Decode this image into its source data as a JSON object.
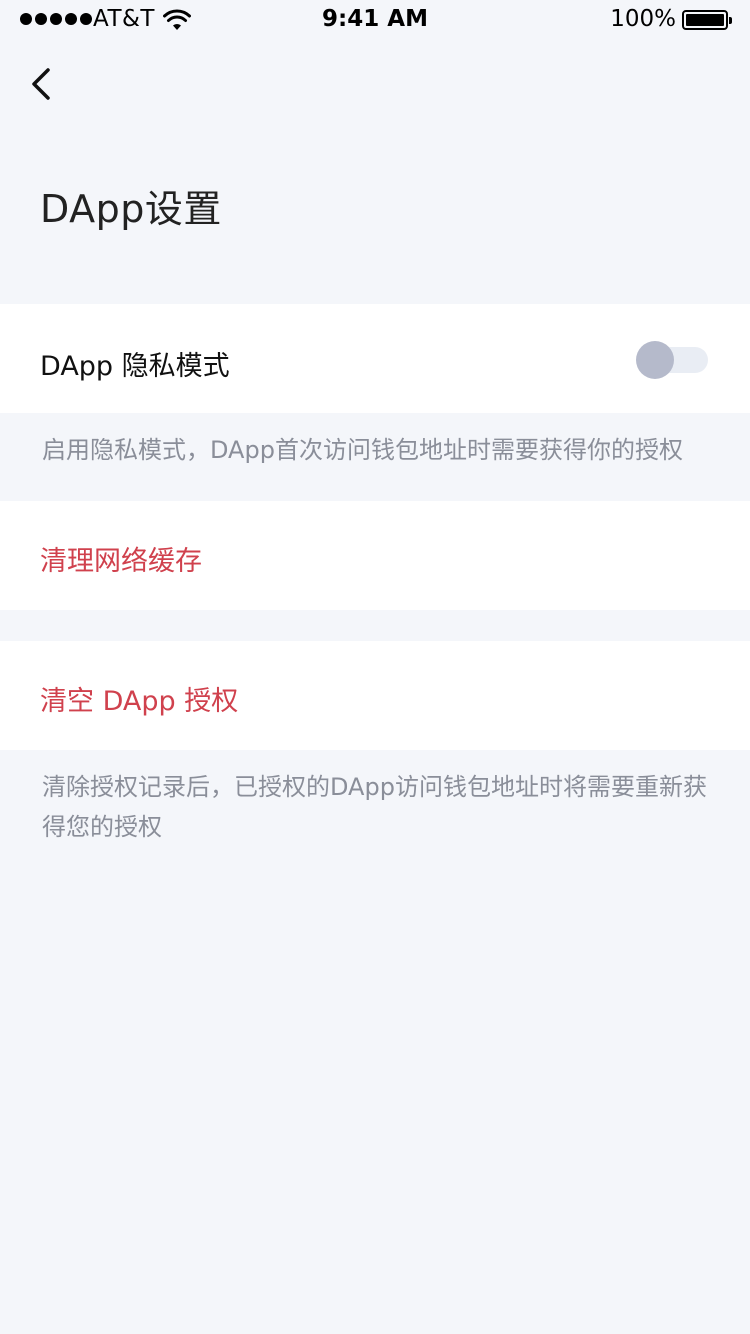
{
  "status_bar": {
    "carrier": "AT&T",
    "time": "9:41 AM",
    "battery_percent": "100%",
    "battery_level": 1.0,
    "signal_bars": 5
  },
  "nav": {
    "back_icon": "chevron-left-icon"
  },
  "header": {
    "title": "DApp设置"
  },
  "settings": {
    "privacy_mode": {
      "label": "DApp 隐私模式",
      "enabled": false,
      "note": "启用隐私模式，DApp首次访问钱包地址时需要获得你的授权"
    },
    "clear_cache": {
      "label": "清理网络缓存"
    },
    "clear_auth": {
      "label": "清空 DApp 授权",
      "note": "清除授权记录后，已授权的DApp访问钱包地址时将需要重新获得您的授权"
    }
  },
  "colors": {
    "background": "#f4f6fa",
    "danger": "#d0414d",
    "note_text": "#8a8e99",
    "toggle_knob": "#b5bacb"
  }
}
